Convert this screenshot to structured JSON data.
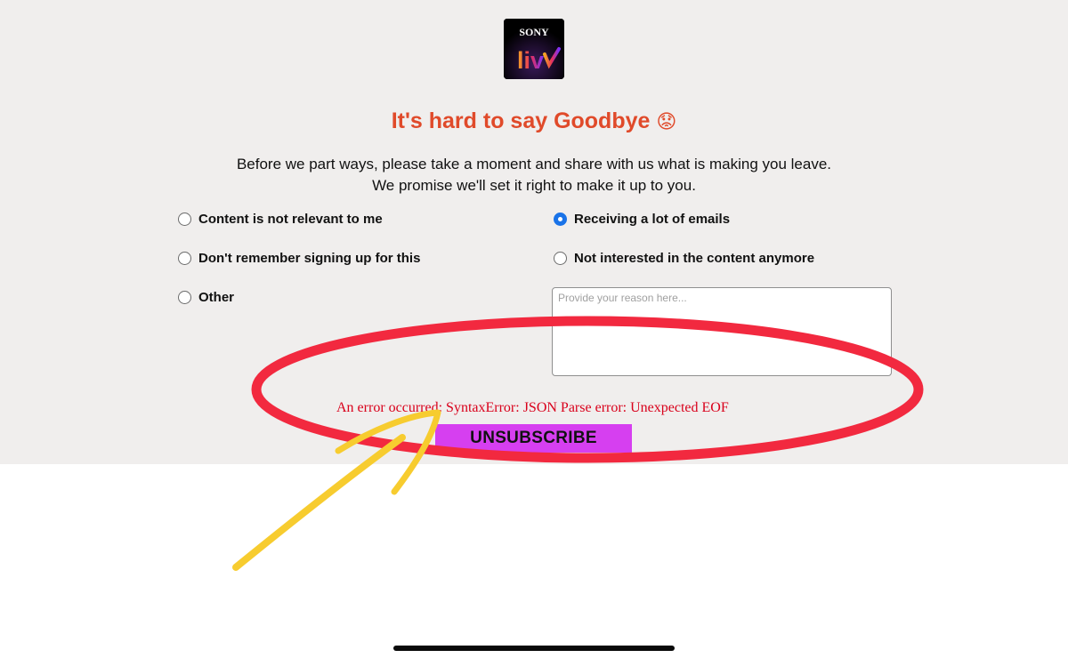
{
  "logo": {
    "brand_top": "SONY",
    "brand_bottom": "liv"
  },
  "title": {
    "text": "It's hard to say Goodbye",
    "emoji": "😟"
  },
  "subtitle": {
    "line1": "Before we part ways, please take a moment and share with us what is making you leave.",
    "line2": "We promise we'll set it right to make it up to you."
  },
  "options": [
    {
      "label": "Content is not relevant to me",
      "checked": false
    },
    {
      "label": "Receiving a lot of emails",
      "checked": true
    },
    {
      "label": "Don't remember signing up for this",
      "checked": false
    },
    {
      "label": "Not interested in the content anymore",
      "checked": false
    },
    {
      "label": "Other",
      "checked": false
    }
  ],
  "reason": {
    "placeholder": "Provide your reason here...",
    "value": ""
  },
  "error": {
    "text": "An error occurred: SyntaxError: JSON Parse error: Unexpected EOF"
  },
  "unsubscribe": {
    "label": "UNSUBSCRIBE"
  },
  "colors": {
    "panel_bg": "#f0eeed",
    "title": "#e04a2a",
    "error": "#d9001b",
    "button": "#d63ff0",
    "radio_checked": "#1a73e8",
    "annotation_circle": "#f2293f",
    "annotation_arrow": "#f7cc2f"
  }
}
